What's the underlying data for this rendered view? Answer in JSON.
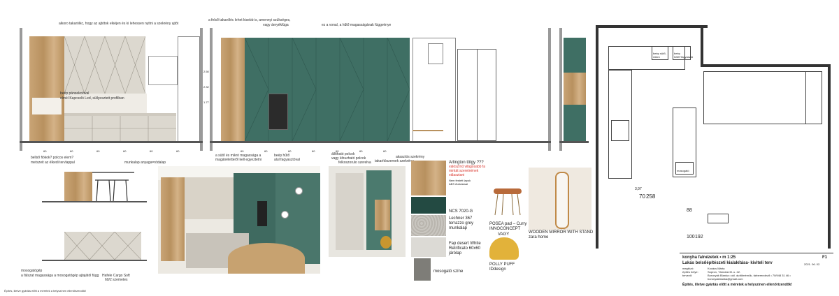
{
  "annotations": {
    "top_left": "alkoro takarólkc, hogy az ajtótok elkéjen és ki lehessen nyitni a szekrény ajtót",
    "top_mid_1": "a felső takaróléc lehet kisebb is, amennyi szükséges,",
    "top_mid_2": "vagy árnyékfúga",
    "top_mid_3": "ez a vonal, a hűtő magasságának függvénye",
    "elev_left_note_1": "beép pánsekcióval",
    "elev_left_note_2": "elmél Kapcsoló Led, süllyesztett profilban",
    "bottom_left_1": "bellső fiókok?  polcos elem?",
    "bottom_left_2": "metszeit az élkedi tervlappal",
    "bottom_mid_1": "a sütő és mikró magassága a",
    "bottom_mid_2": "magánéletteről kell egyeztetni",
    "bottom_mid_3": "beép hűtő",
    "bottom_mid_4": "alul fagyasztóval",
    "bottom_mid_5": "állítható polcok",
    "bottom_mid_6": "vagy kihuzható polcok",
    "bottom_mid_7": "felkoszorulo szerelva",
    "bottom_mid_8": "takarítószernek szekrény",
    "bottom_mid_9": "akasztós szekrény",
    "munkalap": "munkalap anyaga=ródalap",
    "mosogatogep_1": "mosogatógép",
    "mosogatogep_2": "a fálszat magassága a mosogatógép ajtajától függ",
    "hafele": "Hafele Cargo Soft",
    "hafele_2": "60/2 szemetes",
    "mosogato_szine": "mosogató színe",
    "footer_note": "Építés, illetve gyártás előtt a méretek a helyszínen ellenőrizendők!"
  },
  "elevation_dims": {
    "left": [
      "60",
      "60",
      "60",
      "60",
      "60",
      "60"
    ],
    "mid": [
      "60",
      "60",
      "60",
      "60",
      "60",
      "60",
      "60"
    ],
    "heights": [
      "2.50",
      "2.32",
      "1.77"
    ]
  },
  "plan": {
    "labels": [
      "beép sütő, mikró",
      "beép hűtő+fagyasztó",
      "mosogató"
    ],
    "dims": [
      "70",
      "258",
      "88",
      "100",
      "192"
    ],
    "dim_misc": "3,97"
  },
  "materials": {
    "oak_title": "Arlington tölgy ???",
    "oak_red_1": "valószínű világosabb fa",
    "oak_red_2": "mintát szeretnének",
    "oak_red_3": "választani",
    "oak_sub_1": "Nem festett lapok",
    "oak_sub_2": "ABS élzárással",
    "ncs": "NCS 7020-G",
    "lechner_1": "Lechner 367",
    "lechner_2": "terrazzo grey",
    "lechner_3": "munkalap",
    "fap_1": "Fap desert White",
    "fap_2": "Retrificato 60x60",
    "fap_3": "járólap"
  },
  "furniture": {
    "posea_1": "POSEA pad – Curry",
    "posea_2": "INNOCONCEPT",
    "vagy": "VAGY",
    "polly_1": "POLLY PUFF",
    "polly_2": "IDdesign",
    "mirror_1": "WOODEN MIRROR WITH STAND",
    "mirror_2": "zara home"
  },
  "titleblock": {
    "title": "konyha falnézetek • m 1:25",
    "sheet": "F1",
    "project": "Lakás belsőépítészeti kialakítása- kiviteli terv",
    "megbizo_label": "megbízó:",
    "megbizo": "Kovács Márta",
    "helyszin_label": "építés helye:",
    "helyszin": "Sopron, Tárnoksi M. u. 22.",
    "tervezo_label": "tervező:",
    "tervezo": "Boronyák Bianka • okl. építőmérnök, tárberendező • 70/948 31 46 •",
    "email": "boronyakbianka@gmail.com",
    "date": "2021. 06. 02.",
    "warning": "Építés, illetve gyártás előtt a méretek a helyszínen ellenőrizendők!"
  }
}
